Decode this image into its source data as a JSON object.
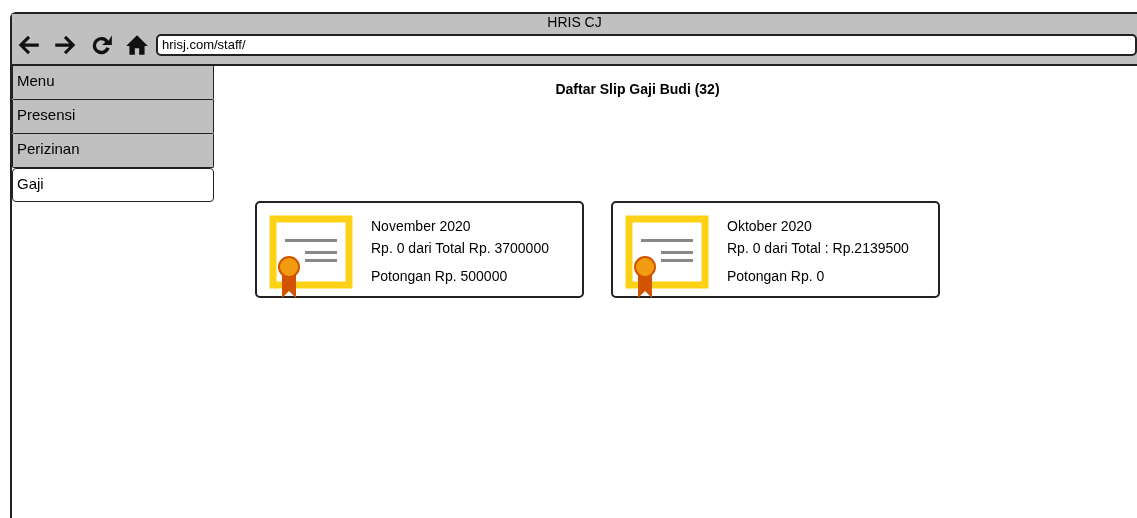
{
  "window": {
    "title": "HRIS CJ"
  },
  "address_bar": {
    "value": "hrisj.com/staff/"
  },
  "sidebar": {
    "items": [
      {
        "label": "Menu",
        "selected": false
      },
      {
        "label": "Presensi",
        "selected": false
      },
      {
        "label": "Perizinan",
        "selected": false
      },
      {
        "label": "Gaji",
        "selected": true
      }
    ]
  },
  "page_title": "Daftar Slip Gaji Budi (32)",
  "slips": [
    {
      "period": "November 2020",
      "amount": "Rp. 0 dari Total Rp. 3700000",
      "deduction": "Potongan Rp. 500000"
    },
    {
      "period": "Oktober 2020",
      "amount": "Rp. 0 dari Total : Rp.2139500",
      "deduction": "Potongan Rp. 0"
    }
  ]
}
